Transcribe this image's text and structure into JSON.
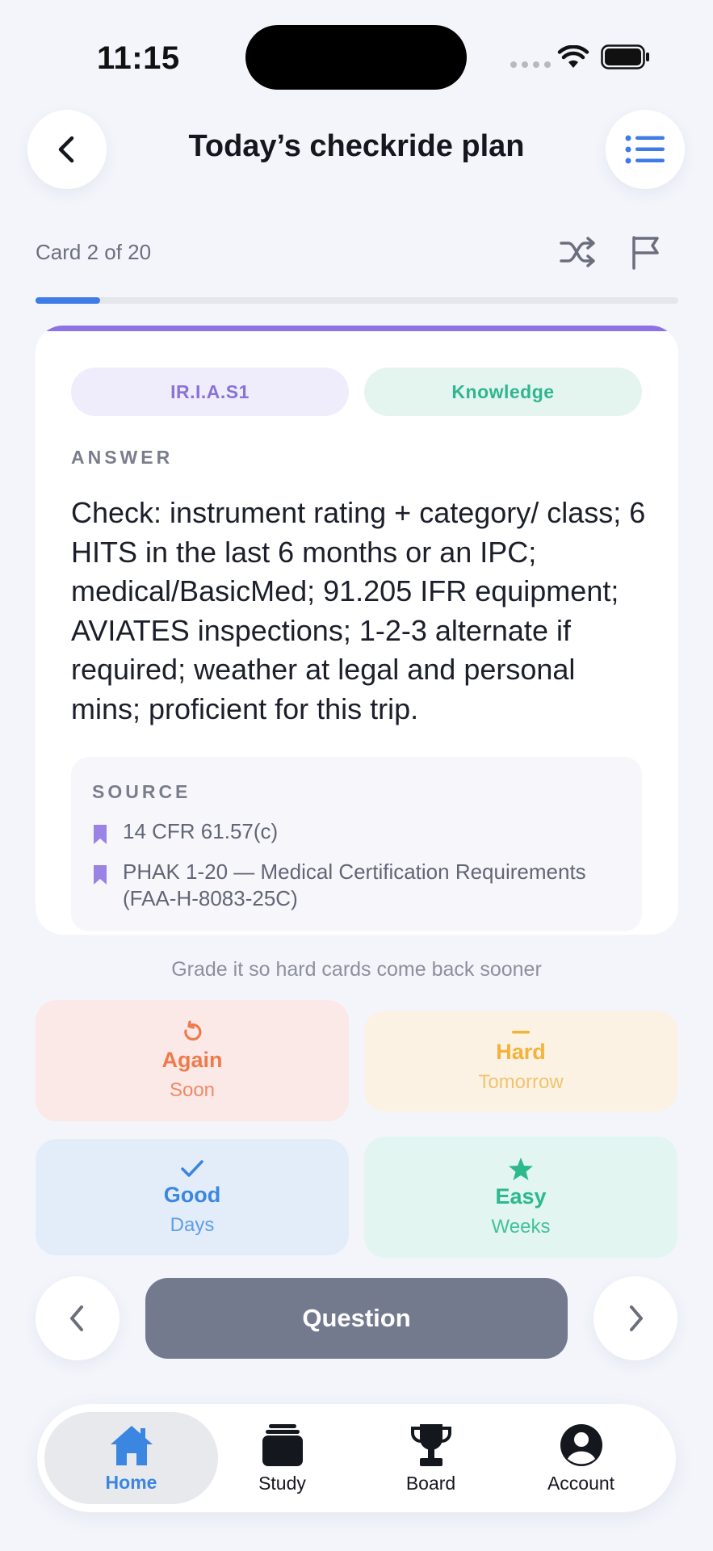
{
  "status_bar": {
    "time": "11:15"
  },
  "header": {
    "title": "Today’s checkride plan"
  },
  "progress": {
    "label": "Card 2 of 20",
    "current": 2,
    "total": 20,
    "fraction": 0.1
  },
  "card": {
    "tags": [
      "IR.I.A.S1",
      "Knowledge"
    ],
    "answer_label": "ANSWER",
    "answer_text": "Check: instrument rating + category/ class; 6 HITS in the last 6 months or an IPC; medical/BasicMed; 91.205 IFR equipment; AVIATES inspections; 1-2-3 alternate if required; weather at legal and personal mins; proficient for this trip.",
    "source_label": "SOURCE",
    "sources": [
      "14 CFR 61.57(c)",
      "PHAK 1-20 — Medical Certification Requirements (FAA-H-8083-25C)"
    ]
  },
  "grade_hint": "Grade it so hard cards come back sooner",
  "grades": [
    {
      "label": "Again",
      "interval": "Soon",
      "icon": "retry-icon",
      "color": "#ef7a4a"
    },
    {
      "label": "Hard",
      "interval": "Tomorrow",
      "icon": "dash-icon",
      "color": "#f4b23a"
    },
    {
      "label": "Good",
      "interval": "Days",
      "icon": "check-icon",
      "color": "#3b87e0"
    },
    {
      "label": "Easy",
      "interval": "Weeks",
      "icon": "star-icon",
      "color": "#2cb98c"
    }
  ],
  "pager": {
    "flip_label": "Question"
  },
  "tabs": [
    {
      "label": "Home",
      "icon": "home-icon",
      "active": true
    },
    {
      "label": "Study",
      "icon": "study-icon",
      "active": false
    },
    {
      "label": "Board",
      "icon": "trophy-icon",
      "active": false
    },
    {
      "label": "Account",
      "icon": "account-icon",
      "active": false
    }
  ],
  "colors": {
    "accent": "#3e7be6",
    "card_top": "#8d72e6"
  }
}
